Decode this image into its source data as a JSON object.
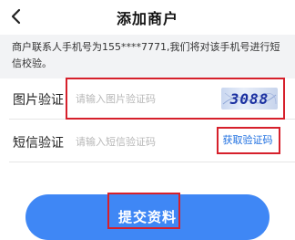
{
  "nav": {
    "title": "添加商户"
  },
  "notice": {
    "text": "商户联系人手机号为155****7771,我们将对该手机号进行短信校验。"
  },
  "captcha_row": {
    "label": "图片验证",
    "placeholder": "请输入图片验证码",
    "captcha_code": "3088"
  },
  "sms_row": {
    "label": "短信验证",
    "placeholder": "请输入短信验证码",
    "get_code_label": "获取验证码"
  },
  "submit": {
    "label": "提交资料"
  },
  "colors": {
    "accent": "#3f87f5",
    "link": "#1e6fe0",
    "highlight_box": "#d6202b",
    "notice_bg": "#f2f3f5"
  },
  "icons": {
    "back": "chevron-left-icon"
  }
}
